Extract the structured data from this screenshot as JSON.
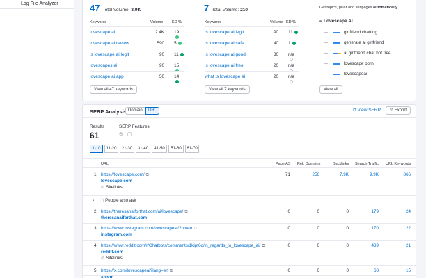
{
  "sidebar": {
    "log_file_analyzer": "Log File Analyzer"
  },
  "columns": [
    {
      "count": "47",
      "total_label": "Total Volume:",
      "total_value": "3.9K",
      "hdr_keywords": "Keywords",
      "hdr_volume": "Volume",
      "hdr_kd": "KD %",
      "rows": [
        {
          "kw": "lovescape ai",
          "vol": "2.4K",
          "kd": "19",
          "color": "#3cc481"
        },
        {
          "kw": "lovescape ai review",
          "vol": "590",
          "kd": "5",
          "color": "#3cc481"
        },
        {
          "kw": "is lovescape ai legit",
          "vol": "90",
          "kd": "11",
          "color": "#009f6b"
        },
        {
          "kw": "lovescapes ai",
          "vol": "90",
          "kd": "15",
          "color": "#3cc481"
        },
        {
          "kw": "lovescape ai app",
          "vol": "50",
          "kd": "14",
          "color": "#009f6b"
        }
      ],
      "view_all": "View all 47 keywords"
    },
    {
      "count": "7",
      "total_label": "Total Volume:",
      "total_value": "210",
      "hdr_keywords": "Keywords",
      "hdr_volume": "Volume",
      "hdr_kd": "KD %",
      "rows": [
        {
          "kw": "is lovescape ai legit",
          "vol": "90",
          "kd": "11",
          "color": "#009f6b"
        },
        {
          "kw": "is lovescape ai safe",
          "vol": "40",
          "kd": "1",
          "color": "#009f6b"
        },
        {
          "kw": "is lovescape ai good",
          "vol": "30",
          "kd": "n/a",
          "color": "#ffffff"
        },
        {
          "kw": "is lovescape ai free",
          "vol": "20",
          "kd": "n/a",
          "color": "#ffffff"
        },
        {
          "kw": "what is lovescape ai",
          "vol": "20",
          "kd": "n/a",
          "color": "#ffffff"
        }
      ],
      "view_all": "View all 7 keywords"
    }
  ],
  "tree": {
    "desc_prefix": "Get topics, pillar and subpages ",
    "desc_bold": "automatically",
    "root": "Lovescape AI",
    "items": [
      {
        "label": "girlfriend chatting",
        "color": "#2e8bf0"
      },
      {
        "label": "generate ai girlfriend",
        "color": "#2e8bf0"
      },
      {
        "label": "ai girlfriend chat bot free",
        "color": "#2e8bf0",
        "accent": "#f2b720"
      },
      {
        "label": "lovescape porn",
        "color": "#2e8bf0"
      },
      {
        "label": "lovescapeai",
        "color": "#2e8bf0"
      }
    ],
    "view_all": "View all"
  },
  "serp": {
    "title": "SERP Analysis",
    "tab_domain": "Domain",
    "tab_url": "URL",
    "view_serp": "View SERP",
    "export": "Export",
    "results_label": "Results",
    "results_value": "61",
    "features_label": "SERP Features",
    "pages": [
      "1-10",
      "11-20",
      "21-30",
      "31-40",
      "41-50",
      "51-60",
      "61-70"
    ],
    "headers": {
      "url": "URL",
      "page_as": "Page AS",
      "ref_domains": "Ref. Domains",
      "backlinks": "Backlinks",
      "search_traffic": "Search Traffic",
      "url_keywords": "URL Keywords"
    },
    "paa": "People also ask",
    "sitelinks": "Sitelinks",
    "rows": [
      {
        "n": "1",
        "url": "https://lovescape.com/",
        "domain": "lovescape.com",
        "as": "71",
        "ref": "256",
        "bl": "7.9K",
        "traffic": "9.9K",
        "kws": "866",
        "sitelinks": true
      },
      {
        "n": "2",
        "url": "https://theresanaiforthat.com/ai/lovescape/",
        "domain": "theresanaiforthat.com",
        "as": "0",
        "ref": "0",
        "bl": "0",
        "traffic": "179",
        "kws": "24",
        "sitelinks": false
      },
      {
        "n": "3",
        "url": "https://www.instagram.com/lovescapeai/?hl=en",
        "domain": "instagram.com",
        "as": "0",
        "ref": "0",
        "bl": "0",
        "traffic": "170",
        "kws": "22",
        "sitelinks": false
      },
      {
        "n": "4",
        "url": "https://www.reddit.com/r/Chatbots/comments/1kipt6d/in_regards_to_lovescape_ai/",
        "domain": "reddit.com",
        "as": "0",
        "ref": "0",
        "bl": "0",
        "traffic": "439",
        "kws": "21",
        "sitelinks": true
      },
      {
        "n": "5",
        "url": "https://x.com/lovescapeai?lang=en",
        "domain": "x.com",
        "as": "0",
        "ref": "0",
        "bl": "0",
        "traffic": "68",
        "kws": "15",
        "sitelinks": false
      }
    ]
  }
}
